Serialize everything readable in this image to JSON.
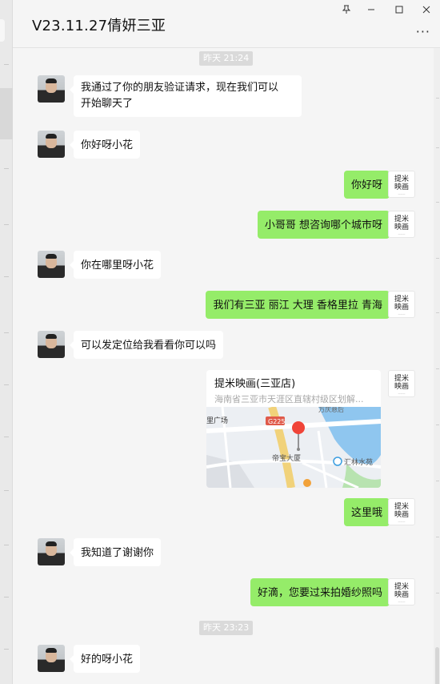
{
  "window": {
    "title": "V23.11.27倩妍三亚",
    "pin_icon": "pin-icon",
    "minimize_icon": "minimize-icon",
    "maximize_icon": "maximize-icon",
    "close_icon": "close-icon",
    "more_icon": "more-icon"
  },
  "timestamps": [
    "昨天 21:24",
    "昨天 23:23"
  ],
  "self_avatar": {
    "line1": "提米",
    "line2": "映画"
  },
  "messages": [
    {
      "from": "other",
      "text_lines": [
        "我通过了你的朋友验证请求，现在我们可以",
        "开始聊天了"
      ]
    },
    {
      "from": "other",
      "text": "你好呀小花"
    },
    {
      "from": "self",
      "text": "你好呀"
    },
    {
      "from": "self",
      "text": "小哥哥 想咨询哪个城市呀"
    },
    {
      "from": "other",
      "text": "你在哪里呀小花"
    },
    {
      "from": "self",
      "text": "我们有三亚 丽江 大理 香格里拉 青海"
    },
    {
      "from": "other",
      "text": "可以发定位给我看看你可以吗"
    },
    {
      "from": "self",
      "type": "location"
    },
    {
      "from": "self",
      "text": "这里哦"
    },
    {
      "from": "other",
      "text": "我知道了谢谢你"
    },
    {
      "from": "self",
      "text": "好滴，您要过来拍婚纱照吗"
    },
    {
      "from": "other",
      "text": "好的呀小花"
    }
  ],
  "location": {
    "name": "提米映画(三亚店)",
    "address": "海南省三亚市天涯区直辖村级区划解...",
    "map_labels": {
      "plaza": "里广场",
      "road": "G225",
      "building": "帝宝大厦",
      "garden": "汇林水苑",
      "top": "万庆悬后"
    }
  },
  "colors": {
    "self_bubble": "#95ec69",
    "other_bubble": "#ffffff",
    "background": "#f5f5f5",
    "pin": "#f04438"
  }
}
